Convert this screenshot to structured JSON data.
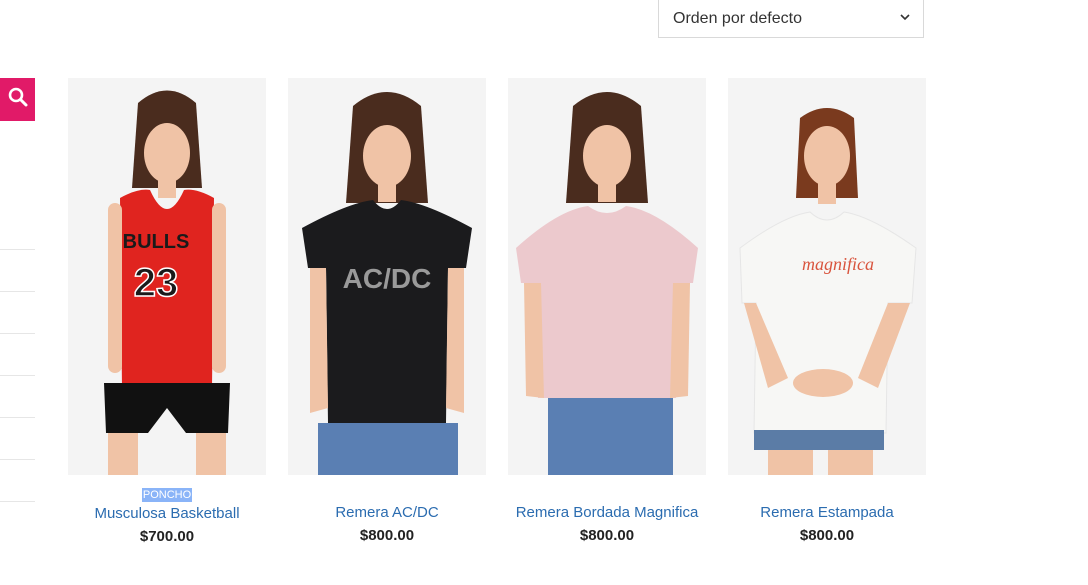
{
  "sort": {
    "label": "Orden por defecto"
  },
  "products": [
    {
      "category": "PONCHO",
      "title": "Musculosa Basketball",
      "price": "$700.00",
      "shirt_color": "#e0241f",
      "jersey_text": "BULLS",
      "jersey_number": "23"
    },
    {
      "category": "",
      "title": "Remera AC/DC",
      "price": "$800.00",
      "shirt_color": "#1b1b1d",
      "print_text": "AC/DC"
    },
    {
      "category": "",
      "title": "Remera Bordada Magnifica",
      "price": "$800.00",
      "shirt_color": "#ecc9cd"
    },
    {
      "category": "",
      "title": "Remera Estampada",
      "price": "$800.00",
      "shirt_color": "#f7f7f5",
      "print_text": "magnifica"
    }
  ]
}
